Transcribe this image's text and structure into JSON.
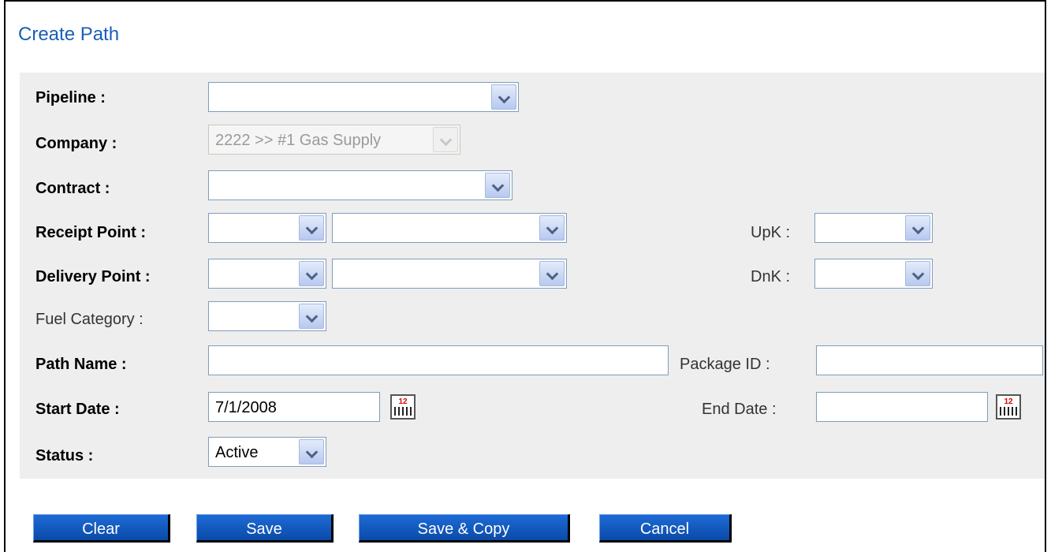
{
  "title": "Create Path",
  "form": {
    "pipeline_label": "Pipeline :",
    "company_label": "Company :",
    "company_value": "2222 >> #1 Gas Supply",
    "contract_label": "Contract :",
    "receipt_point_label": "Receipt Point :",
    "upk_label": "UpK :",
    "delivery_point_label": "Delivery Point :",
    "dnk_label": "DnK :",
    "fuel_category_label": "Fuel Category :",
    "path_name_label": "Path Name :",
    "package_id_label": "Package ID :",
    "start_date_label": "Start Date :",
    "start_date_value": "7/1/2008",
    "end_date_label": "End Date :",
    "status_label": "Status :",
    "status_value": "Active"
  },
  "buttons": {
    "clear": "Clear",
    "save": "Save",
    "save_copy": "Save & Copy",
    "cancel": "Cancel"
  },
  "calendar_icon_text": "12"
}
